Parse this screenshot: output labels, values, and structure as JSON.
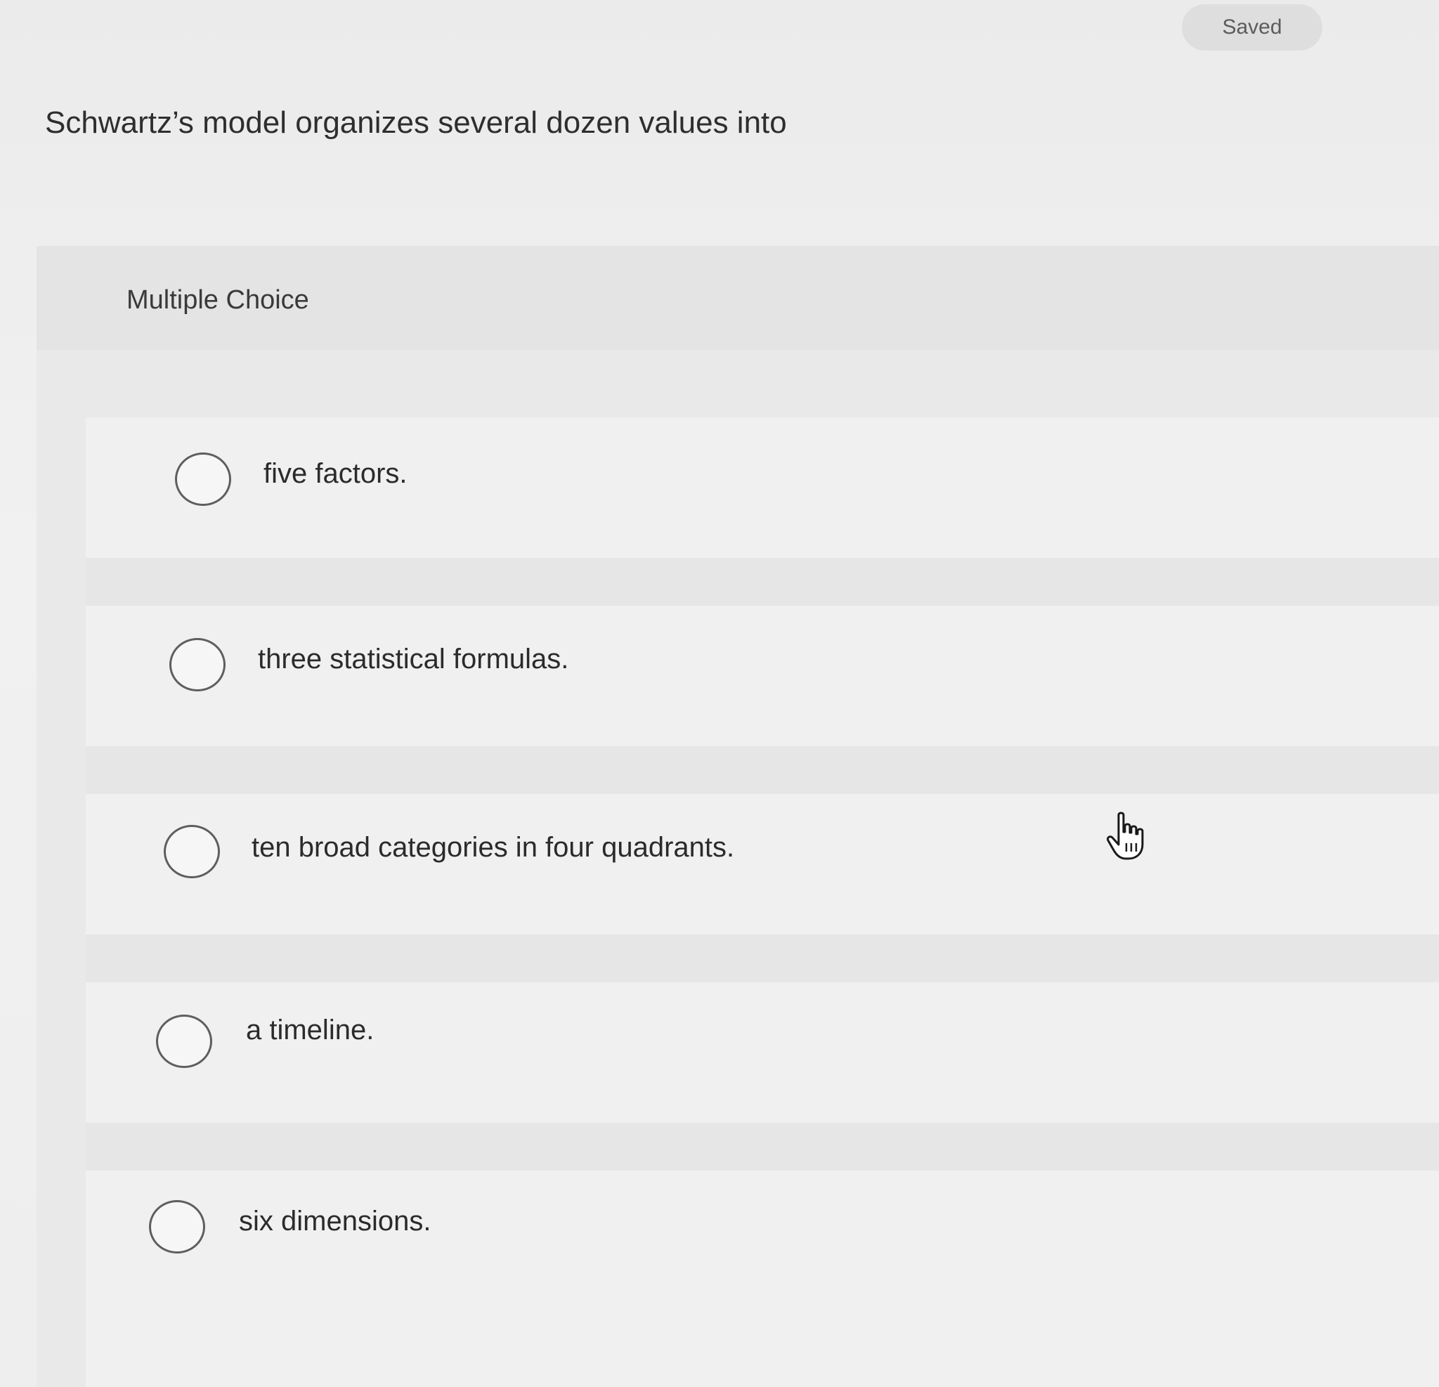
{
  "status": {
    "saved_label": "Saved"
  },
  "question": {
    "prompt": "Schwartz’s model organizes several dozen values into",
    "type_label": "Multiple Choice"
  },
  "options": [
    {
      "label": "five factors.",
      "selected": false
    },
    {
      "label": "three statistical formulas.",
      "selected": false
    },
    {
      "label": "ten broad categories in four quadrants.",
      "selected": false
    },
    {
      "label": "a timeline.",
      "selected": false
    },
    {
      "label": "six dimensions.",
      "selected": false
    }
  ],
  "cursor": {
    "icon": "hand-pointer-icon"
  }
}
